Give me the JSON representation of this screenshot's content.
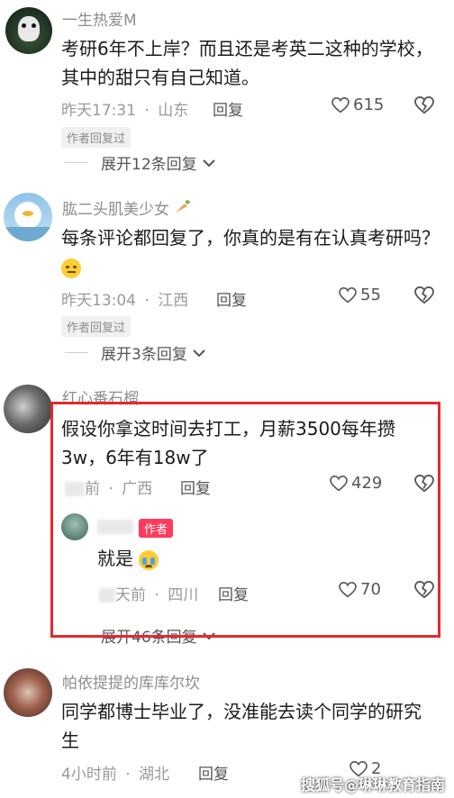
{
  "comments": [
    {
      "username": "一生热爱M",
      "text": "考研6年不上岸？而且还是考英二这种的学校，其中的甜只有自己知道。",
      "time": "昨天17:31",
      "location": "山东",
      "reply_label": "回复",
      "likes": "615",
      "badge": "作者回复过",
      "expand": "展开12条回复"
    },
    {
      "username": "肱二头肌美少女",
      "text": "每条评论都回复了，你真的是有在认真考研吗？",
      "time": "昨天13:04",
      "location": "江西",
      "reply_label": "回复",
      "likes": "55",
      "badge": "作者回复过",
      "expand": "展开3条回复"
    },
    {
      "username": "红心番石榴",
      "text": "假设你拿这时间去打工，月薪3500每年攒3w，6年有18w了",
      "time": "前",
      "location": "广西",
      "reply_label": "回复",
      "likes": "429",
      "sub_reply": {
        "author_tag": "作者",
        "text": "就是",
        "time": "天前",
        "location": "四川",
        "reply_label": "回复",
        "likes": "70"
      },
      "expand": "展开46条回复"
    },
    {
      "username": "帕依提提的库库尔坎",
      "text": "同学都博士毕业了，没准能去读个同学的研究生",
      "time": "4小时前",
      "location": "湖北",
      "reply_label": "回复",
      "likes": "2"
    }
  ],
  "separator": "·",
  "watermark": "搜狐号@琳琳教育指南",
  "colors": {
    "highlight": "#e5282f",
    "author_tag": "#ff3b5c"
  }
}
